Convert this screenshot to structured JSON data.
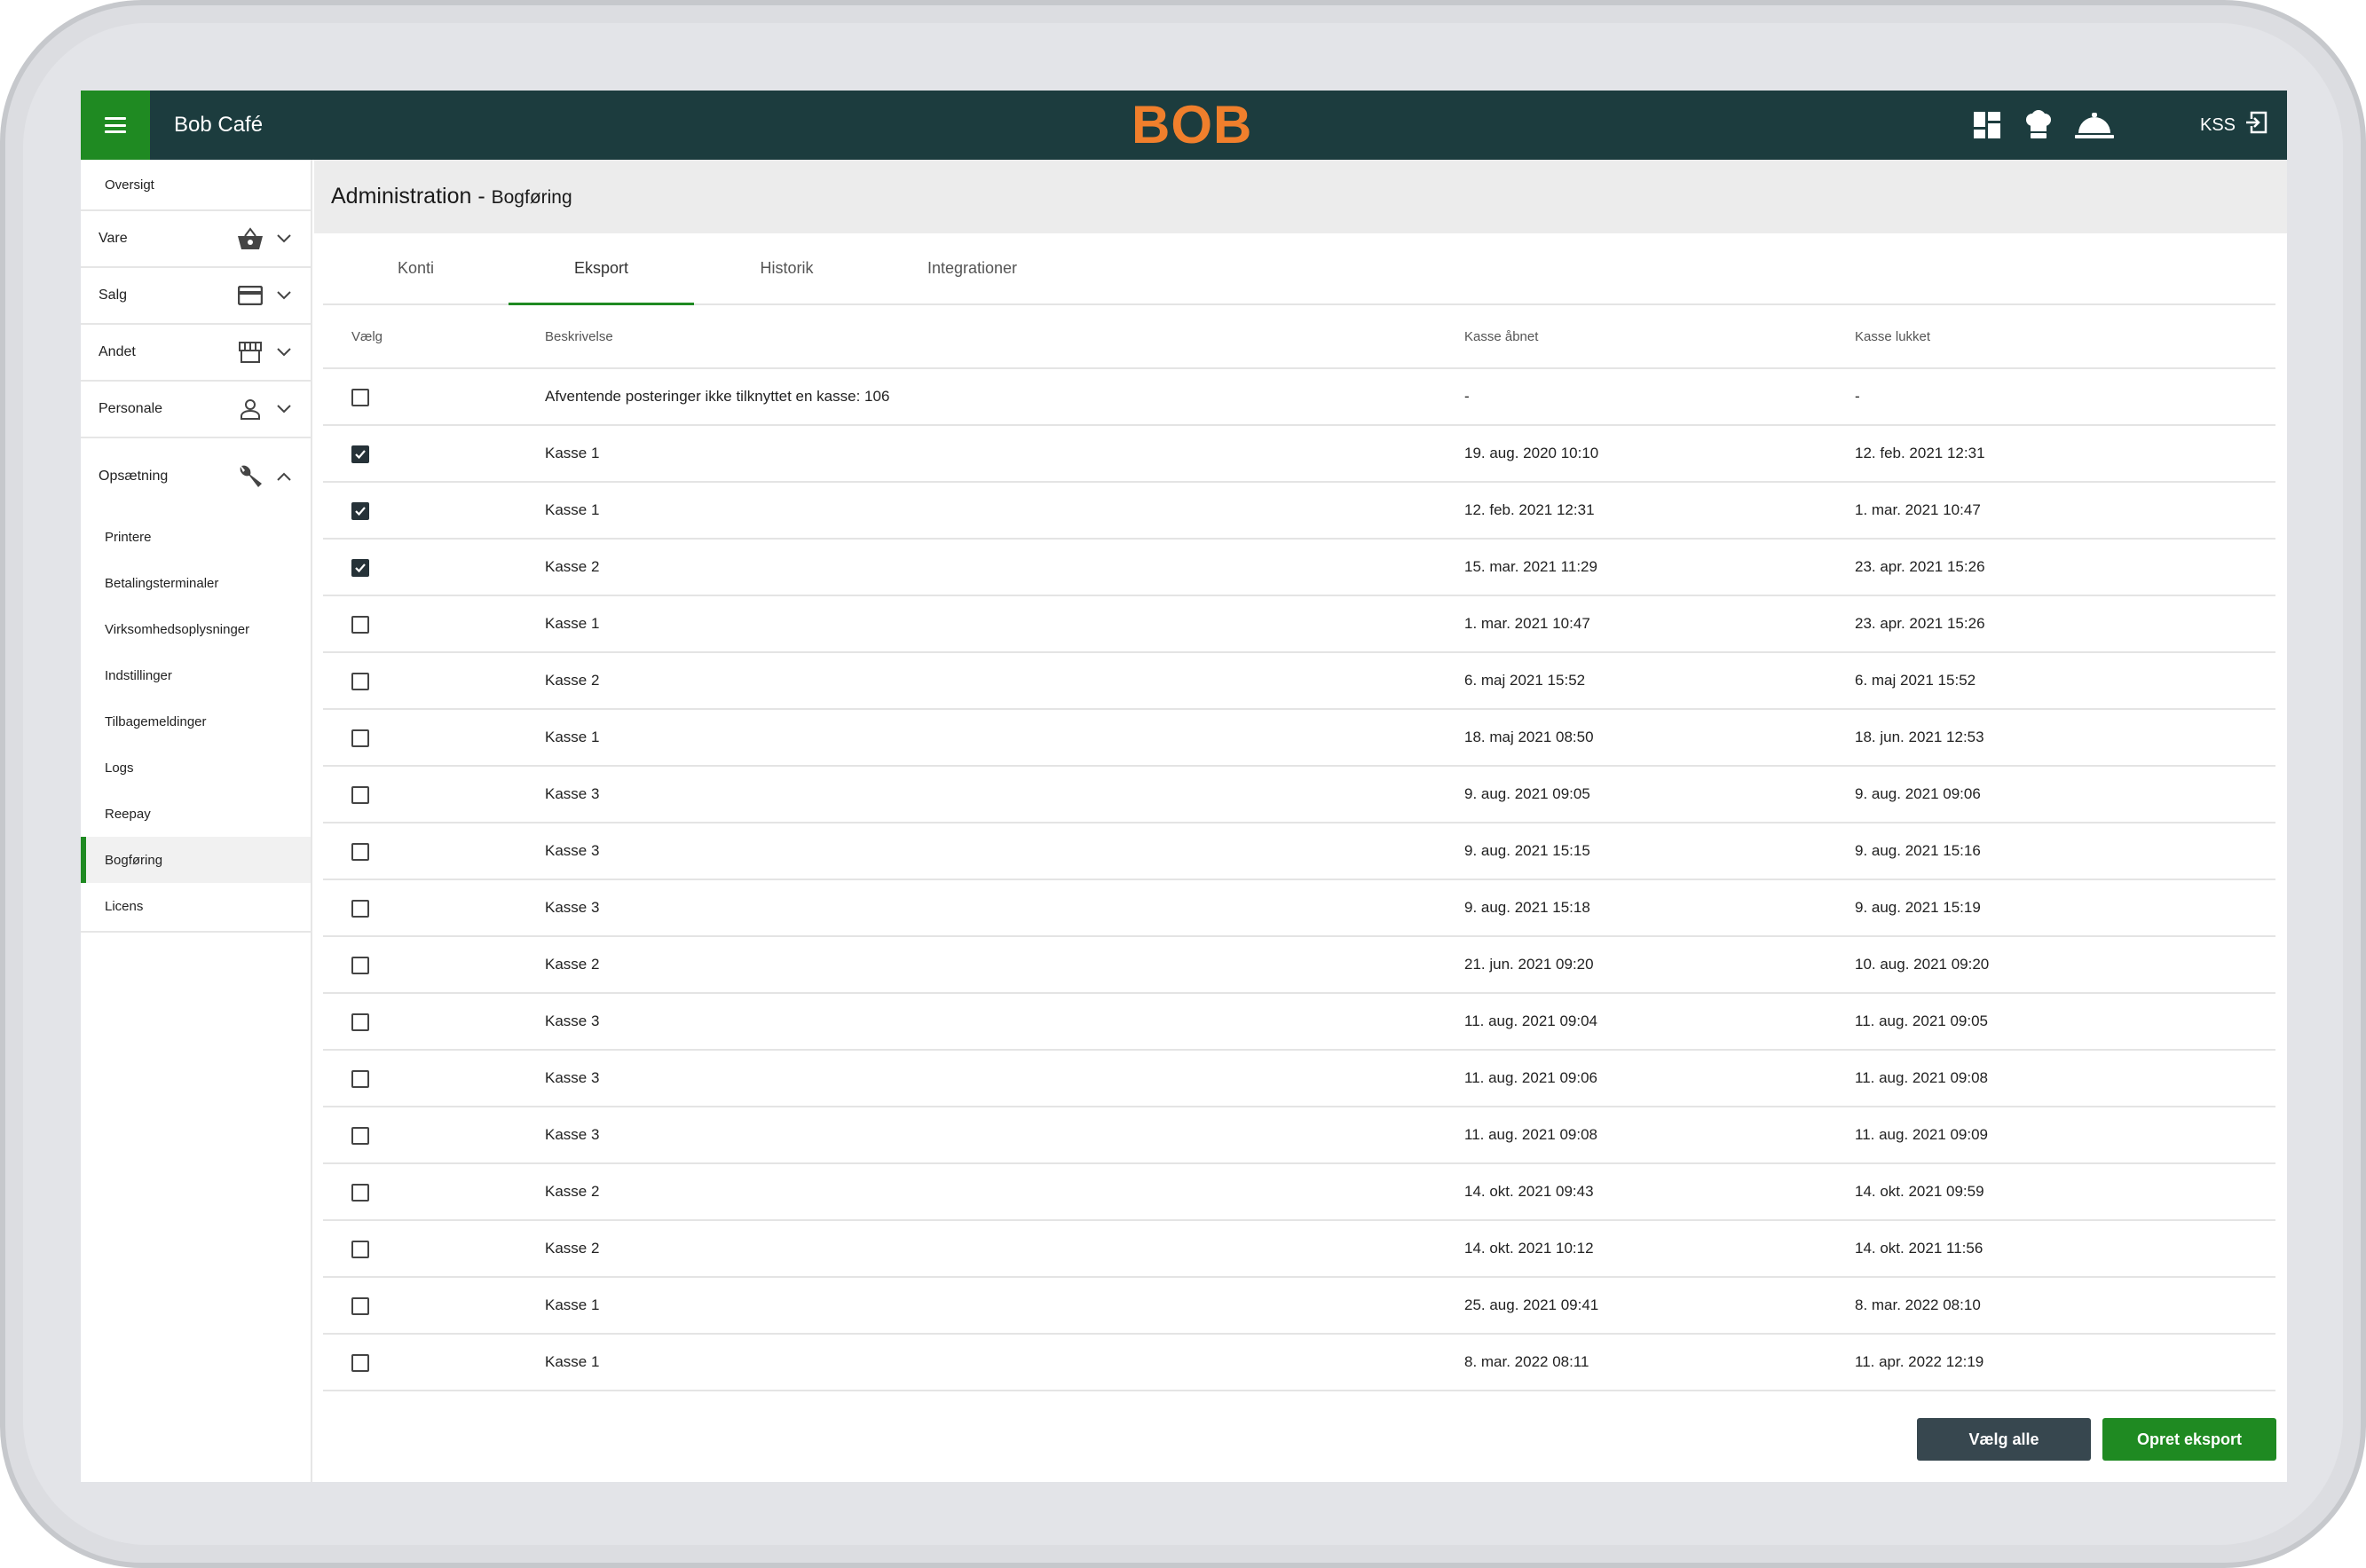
{
  "app": {
    "title": "Bob Café",
    "logo": "BOB",
    "user": "KSS"
  },
  "topbar_icons": [
    "dashboard-icon",
    "chef-hat-icon",
    "cloche-icon"
  ],
  "sidebar": {
    "top_item": "Oversigt",
    "groups": [
      {
        "label": "Vare",
        "icon": "basket-icon"
      },
      {
        "label": "Salg",
        "icon": "credit-card-icon"
      },
      {
        "label": "Andet",
        "icon": "store-icon"
      },
      {
        "label": "Personale",
        "icon": "person-icon"
      },
      {
        "label": "Opsætning",
        "icon": "wrench-icon"
      }
    ],
    "sub_items": [
      "Printere",
      "Betalingsterminaler",
      "Virksomhedsoplysninger",
      "Indstillinger",
      "Tilbagemeldinger",
      "Logs",
      "Reepay",
      "Bogføring",
      "Licens"
    ],
    "active_sub": "Bogføring"
  },
  "page": {
    "title": "Administration",
    "separator": " - ",
    "subtitle": "Bogføring"
  },
  "tabs": [
    "Konti",
    "Eksport",
    "Historik",
    "Integrationer"
  ],
  "active_tab": "Eksport",
  "table": {
    "headers": {
      "select": "Vælg",
      "description": "Beskrivelse",
      "opened": "Kasse åbnet",
      "closed": "Kasse lukket"
    },
    "rows": [
      {
        "checked": false,
        "description": "Afventende posteringer ikke tilknyttet en kasse: 106",
        "opened": "-",
        "closed": "-"
      },
      {
        "checked": true,
        "description": "Kasse 1",
        "opened": "19. aug. 2020 10:10",
        "closed": "12. feb. 2021 12:31"
      },
      {
        "checked": true,
        "description": "Kasse 1",
        "opened": "12. feb. 2021 12:31",
        "closed": "1. mar. 2021 10:47"
      },
      {
        "checked": true,
        "description": "Kasse 2",
        "opened": "15. mar. 2021 11:29",
        "closed": "23. apr. 2021 15:26"
      },
      {
        "checked": false,
        "description": "Kasse 1",
        "opened": "1. mar. 2021 10:47",
        "closed": "23. apr. 2021 15:26"
      },
      {
        "checked": false,
        "description": "Kasse 2",
        "opened": "6. maj 2021 15:52",
        "closed": "6. maj 2021 15:52"
      },
      {
        "checked": false,
        "description": "Kasse 1",
        "opened": "18. maj 2021 08:50",
        "closed": "18. jun. 2021 12:53"
      },
      {
        "checked": false,
        "description": "Kasse 3",
        "opened": "9. aug. 2021 09:05",
        "closed": "9. aug. 2021 09:06"
      },
      {
        "checked": false,
        "description": "Kasse 3",
        "opened": "9. aug. 2021 15:15",
        "closed": "9. aug. 2021 15:16"
      },
      {
        "checked": false,
        "description": "Kasse 3",
        "opened": "9. aug. 2021 15:18",
        "closed": "9. aug. 2021 15:19"
      },
      {
        "checked": false,
        "description": "Kasse 2",
        "opened": "21. jun. 2021 09:20",
        "closed": "10. aug. 2021 09:20"
      },
      {
        "checked": false,
        "description": "Kasse 3",
        "opened": "11. aug. 2021 09:04",
        "closed": "11. aug. 2021 09:05"
      },
      {
        "checked": false,
        "description": "Kasse 3",
        "opened": "11. aug. 2021 09:06",
        "closed": "11. aug. 2021 09:08"
      },
      {
        "checked": false,
        "description": "Kasse 3",
        "opened": "11. aug. 2021 09:08",
        "closed": "11. aug. 2021 09:09"
      },
      {
        "checked": false,
        "description": "Kasse 2",
        "opened": "14. okt. 2021 09:43",
        "closed": "14. okt. 2021 09:59"
      },
      {
        "checked": false,
        "description": "Kasse 2",
        "opened": "14. okt. 2021 10:12",
        "closed": "14. okt. 2021 11:56"
      },
      {
        "checked": false,
        "description": "Kasse 1",
        "opened": "25. aug. 2021 09:41",
        "closed": "8. mar. 2022 08:10"
      },
      {
        "checked": false,
        "description": "Kasse 1",
        "opened": "8. mar. 2022 08:11",
        "closed": "11. apr. 2022 12:19"
      }
    ]
  },
  "buttons": {
    "select_all": "Vælg alle",
    "create_export": "Opret eksport"
  },
  "colors": {
    "topbar": "#1c3c3e",
    "accent_green": "#1f8a22",
    "logo_orange": "#f07f2c",
    "button_grey": "#37474f"
  }
}
